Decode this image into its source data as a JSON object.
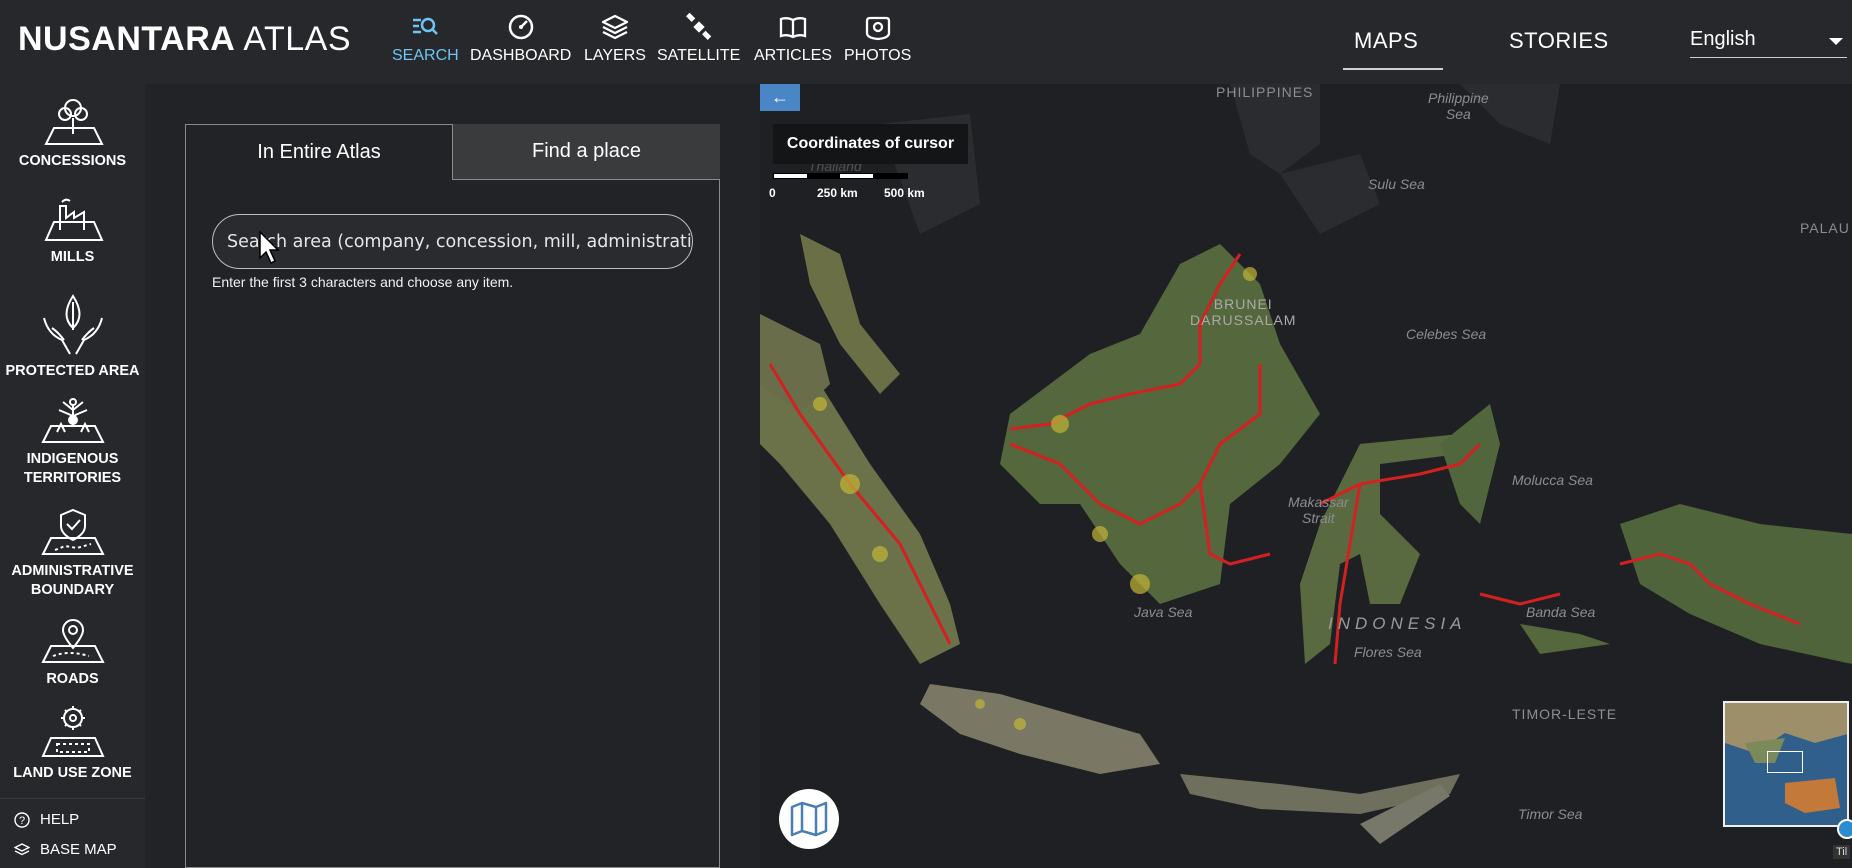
{
  "app": {
    "logo_bold": "NUSANTARA",
    "logo_light": "ATLAS"
  },
  "topnav": [
    {
      "label": "SEARCH",
      "icon": "search-list-icon",
      "active": true
    },
    {
      "label": "DASHBOARD",
      "icon": "gauge-icon"
    },
    {
      "label": "LAYERS",
      "icon": "layers-icon"
    },
    {
      "label": "SATELLITE",
      "icon": "satellite-icon"
    },
    {
      "label": "ARTICLES",
      "icon": "book-icon"
    },
    {
      "label": "PHOTOS",
      "icon": "camera-icon"
    }
  ],
  "rightnav": {
    "maps": "MAPS",
    "stories": "STORIES",
    "language": "English"
  },
  "sidebar": {
    "items": [
      {
        "label": "CONCESSIONS",
        "icon": "tree-plot-icon"
      },
      {
        "label": "MILLS",
        "icon": "factory-icon"
      },
      {
        "label": "PROTECTED AREA",
        "icon": "hands-leaf-icon"
      },
      {
        "label": "INDIGENOUS TERRITORIES",
        "icon": "people-tree-icon"
      },
      {
        "label": "ADMINISTRATIVE BOUNDARY",
        "icon": "shield-boundary-icon"
      },
      {
        "label": "ROADS",
        "icon": "road-pin-icon"
      },
      {
        "label": "LAND USE ZONE",
        "icon": "gear-zone-icon"
      }
    ],
    "help": "HELP",
    "base_map": "BASE MAP"
  },
  "panel": {
    "tab_active": "In Entire Atlas",
    "tab_inactive": "Find a place",
    "search_placeholder": "Search area (company, concession, mill, administrative",
    "hint": "Enter the first 3 characters and choose any item."
  },
  "map": {
    "coords_label": "Coordinates of cursor",
    "scale_labels": [
      "0",
      "250 km",
      "500 km"
    ],
    "labels": {
      "philippines": "PHILIPPINES",
      "philippine_sea": "Philippine\nSea",
      "sulu_sea": "Sulu Sea",
      "palau": "PALAU",
      "thailand": "Thailand",
      "brunei": "BRUNEI\nDARUSSALAM",
      "celebes_sea": "Celebes Sea",
      "molucca_sea": "Molucca Sea",
      "makassar": "Makassar\nStrait",
      "java_sea": "Java Sea",
      "indonesia": "INDONESIA",
      "banda_sea": "Banda Sea",
      "flores_sea": "Flores Sea",
      "timor_leste": "TIMOR-LESTE",
      "timor_sea": "Timor Sea"
    },
    "tile_label": "Til",
    "colors": {
      "land": "#5a6e3f",
      "boundary": "#d42020",
      "sea": "#1f2023",
      "accent": "#6ec4f2"
    }
  }
}
